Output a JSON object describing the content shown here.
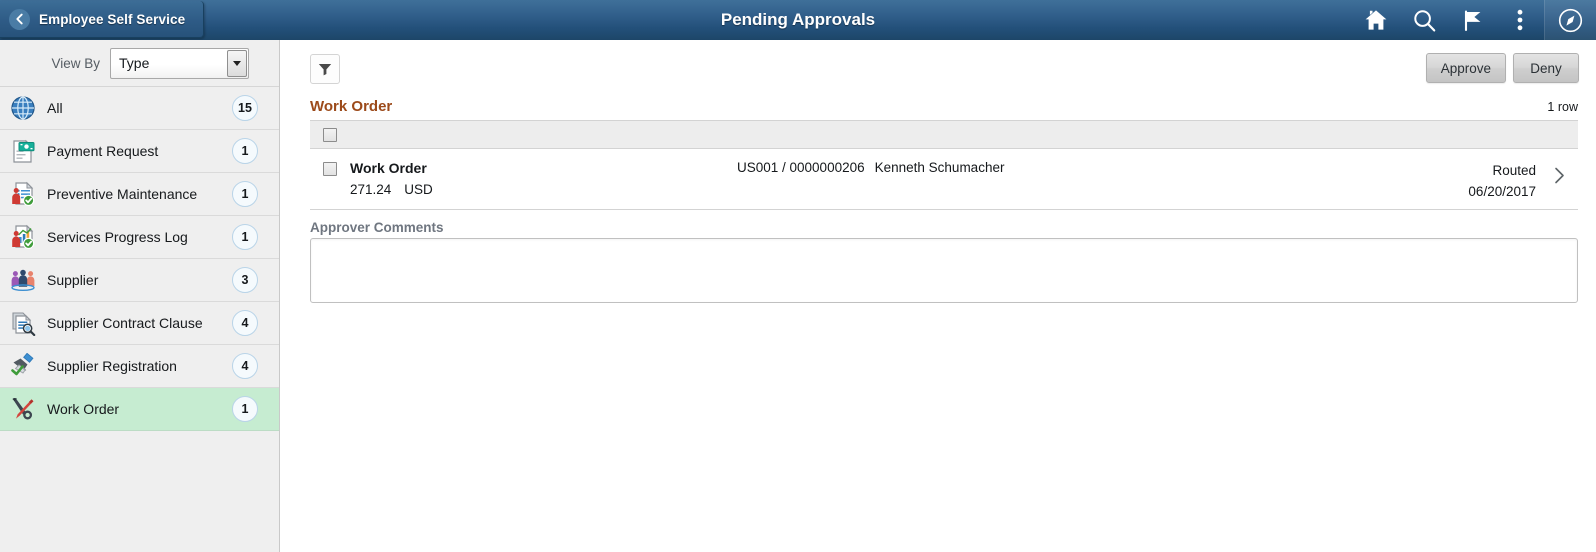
{
  "header": {
    "back_label": "Employee Self Service",
    "title": "Pending Approvals",
    "icons": [
      "home-icon",
      "search-icon",
      "notifications-flag-icon",
      "actions-menu-icon",
      "navbar-compass-icon"
    ]
  },
  "sidebar": {
    "view_by_label": "View By",
    "view_by_value": "Type",
    "items": [
      {
        "label": "All",
        "count": "15",
        "icon": "globe-icon",
        "selected": false
      },
      {
        "label": "Payment Request",
        "count": "1",
        "icon": "payment-request-icon",
        "selected": false
      },
      {
        "label": "Preventive Maintenance",
        "count": "1",
        "icon": "preventive-maintenance-icon",
        "selected": false
      },
      {
        "label": "Services Progress Log",
        "count": "1",
        "icon": "services-progress-log-icon",
        "selected": false
      },
      {
        "label": "Supplier",
        "count": "3",
        "icon": "supplier-icon",
        "selected": false
      },
      {
        "label": "Supplier Contract Clause",
        "count": "4",
        "icon": "supplier-contract-clause-icon",
        "selected": false
      },
      {
        "label": "Supplier Registration",
        "count": "4",
        "icon": "supplier-registration-icon",
        "selected": false
      },
      {
        "label": "Work Order",
        "count": "1",
        "icon": "work-order-icon",
        "selected": true
      }
    ]
  },
  "toolbar": {
    "filter_icon": "filter-funnel-icon",
    "approve_label": "Approve",
    "deny_label": "Deny"
  },
  "main": {
    "section_title": "Work Order",
    "row_count_label": "1 row",
    "rows": [
      {
        "title": "Work Order",
        "amount": "271.24",
        "currency": "USD",
        "business_unit_id": "US001 / 0000000206",
        "requester": "Kenneth Schumacher",
        "status": "Routed",
        "date": "06/20/2017"
      }
    ],
    "comments_label": "Approver Comments",
    "comments_value": "",
    "comments_placeholder": ""
  },
  "colors": {
    "header_blue": "#2e5b86",
    "section_title_brown": "#9c4a1a",
    "selected_row_green": "#c6ecd1",
    "badge_border": "#b9d4e8"
  }
}
